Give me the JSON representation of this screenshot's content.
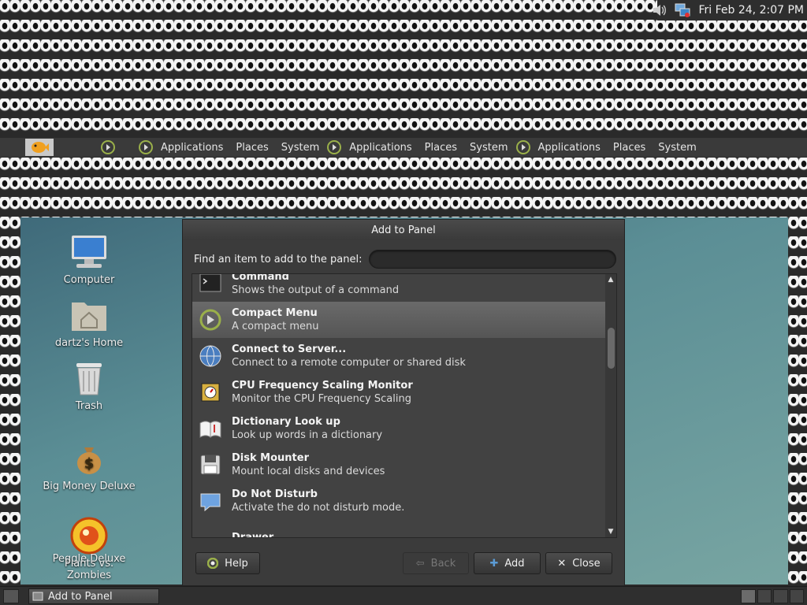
{
  "top_panel": {
    "clock": "Fri Feb 24,  2:07 PM",
    "icons": [
      "volume-icon",
      "network-icon"
    ]
  },
  "menu_panel": {
    "groups": [
      {
        "applications": "Applications",
        "places": "Places",
        "system": "System"
      },
      {
        "applications": "Applications",
        "places": "Places",
        "system": "System"
      },
      {
        "applications": "Applications",
        "places": "Places",
        "system": "System"
      }
    ]
  },
  "desktop": {
    "icons": [
      {
        "label": "Computer"
      },
      {
        "label": "dartz's Home"
      },
      {
        "label": "Trash"
      },
      {
        "label": "Big Money Deluxe"
      },
      {
        "label": "Peggle Deluxe"
      },
      {
        "label": "Plants vs. Zombies"
      }
    ]
  },
  "dialog": {
    "title": "Add to Panel",
    "find_label": "Find an item to add to the panel:",
    "search_value": "",
    "items": [
      {
        "name": "Command",
        "desc": "Shows the output of a command",
        "icon": "terminal-icon"
      },
      {
        "name": "Compact Menu",
        "desc": "A compact menu",
        "icon": "compact-menu-icon"
      },
      {
        "name": "Connect to Server...",
        "desc": "Connect to a remote computer or shared disk",
        "icon": "globe-icon"
      },
      {
        "name": "CPU Frequency Scaling Monitor",
        "desc": "Monitor the CPU Frequency Scaling",
        "icon": "cpu-icon"
      },
      {
        "name": "Dictionary Look up",
        "desc": "Look up words in a dictionary",
        "icon": "dictionary-icon"
      },
      {
        "name": "Disk Mounter",
        "desc": "Mount local disks and devices",
        "icon": "floppy-icon"
      },
      {
        "name": "Do Not Disturb",
        "desc": "Activate the do not disturb mode.",
        "icon": "do-not-disturb-icon"
      },
      {
        "name": "Drawer",
        "desc": "",
        "icon": "drawer-icon"
      }
    ],
    "selected_index": 1,
    "buttons": {
      "help": "Help",
      "back": "Back",
      "add": "Add",
      "close": "Close"
    }
  },
  "bottom_panel": {
    "task": "Add to Panel"
  }
}
